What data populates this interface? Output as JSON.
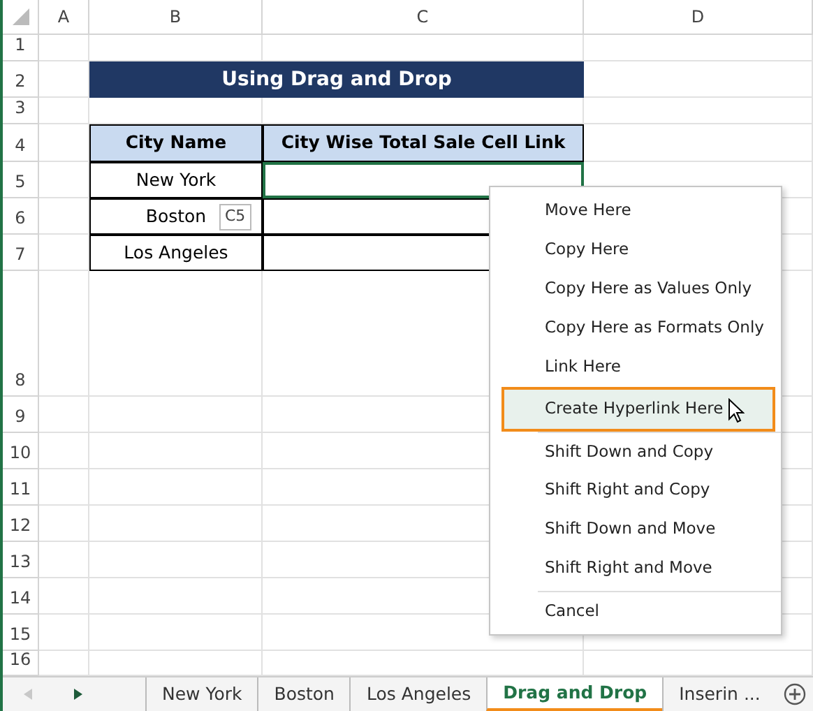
{
  "columns": [
    "A",
    "B",
    "C",
    "D"
  ],
  "rows": [
    "1",
    "2",
    "3",
    "4",
    "5",
    "6",
    "7",
    "8",
    "9",
    "10",
    "11",
    "12",
    "13",
    "14",
    "15",
    "16"
  ],
  "title": "Using Drag and Drop",
  "table": {
    "headers": [
      "City Name",
      "City Wise Total Sale Cell Link"
    ],
    "rows": [
      {
        "city": "New York",
        "link_selected": true
      },
      {
        "city": "Boston",
        "link_selected": false
      },
      {
        "city": "Los Angeles",
        "link_selected": false
      }
    ]
  },
  "drag_tooltip": "C5",
  "context_menu": [
    {
      "label": "Move Here",
      "selected": false,
      "separator_before": false
    },
    {
      "label": "Copy Here",
      "selected": false,
      "separator_before": false
    },
    {
      "label": "Copy Here as Values Only",
      "selected": false,
      "separator_before": false
    },
    {
      "label": "Copy Here as Formats Only",
      "selected": false,
      "separator_before": false
    },
    {
      "label": "Link Here",
      "selected": false,
      "separator_before": false
    },
    {
      "label": "Create Hyperlink Here",
      "selected": true,
      "separator_before": false
    },
    {
      "label": "Shift Down and Copy",
      "selected": false,
      "separator_before": true
    },
    {
      "label": "Shift Right and Copy",
      "selected": false,
      "separator_before": false
    },
    {
      "label": "Shift Down and Move",
      "selected": false,
      "separator_before": false
    },
    {
      "label": "Shift Right and Move",
      "selected": false,
      "separator_before": false
    },
    {
      "label": "Cancel",
      "selected": false,
      "separator_before": true
    }
  ],
  "sheet_tabs": [
    {
      "label": "New York",
      "selected": false
    },
    {
      "label": "Boston",
      "selected": false
    },
    {
      "label": "Los Angeles",
      "selected": false
    },
    {
      "label": "Drag and Drop",
      "selected": true
    },
    {
      "label": "Inserin ...",
      "selected": false
    }
  ]
}
